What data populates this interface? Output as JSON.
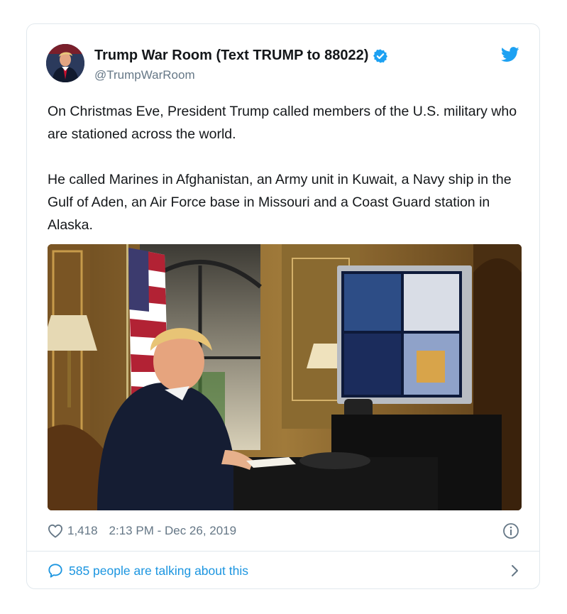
{
  "author": {
    "name": "Trump War Room (Text TRUMP to 88022)",
    "handle": "@TrumpWarRoom",
    "verified": true
  },
  "tweet": {
    "paragraphs": [
      "On Christmas Eve, President Trump called members of the U.S. military who are stationed across the world.",
      "He called Marines in Afghanistan, an Army unit in Kuwait, a Navy ship in the Gulf of Aden, an Air Force base in Missouri and a Coast Guard station in Alaska."
    ]
  },
  "stats": {
    "likes": "1,418",
    "timestamp": "2:13 PM - Dec 26, 2019"
  },
  "conversation": {
    "label": "585 people are talking about this"
  },
  "icons": {
    "brand": "twitter-bird-icon",
    "verified": "verified-badge-icon",
    "like": "heart-icon",
    "info": "info-icon",
    "reply": "speech-bubble-icon",
    "more": "chevron-right-icon"
  },
  "colors": {
    "twitter_blue": "#1da1f2",
    "link_blue": "#1b95e0",
    "text": "#14171a",
    "muted": "#657786",
    "border": "#e1e8ed"
  }
}
